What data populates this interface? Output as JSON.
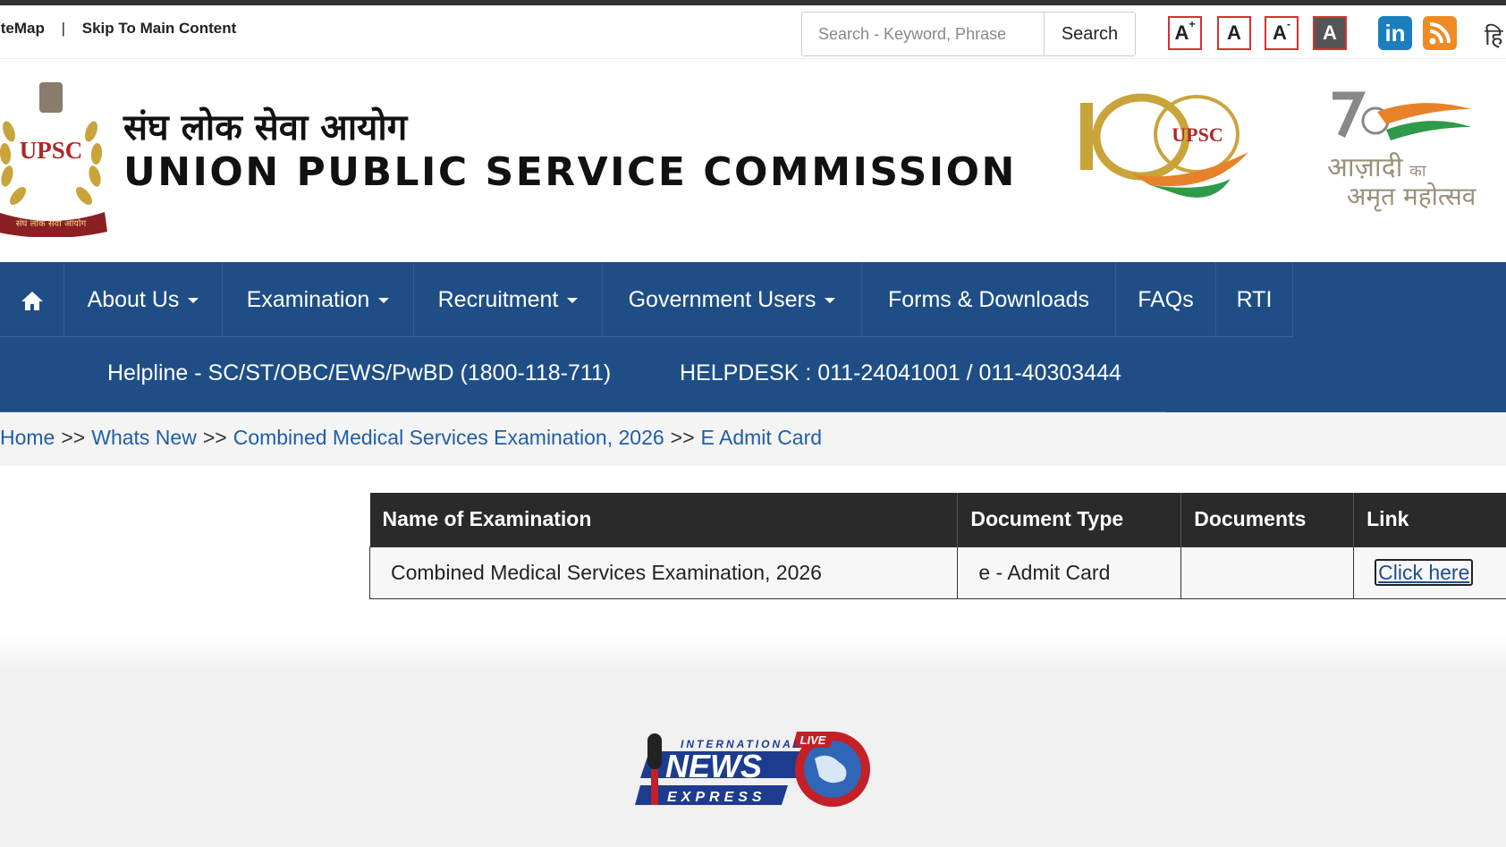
{
  "utility": {
    "sitemap": "iteMap",
    "separator": "|",
    "skip_link": "Skip To Main Content",
    "search_placeholder": "Search - Keyword, Phrase",
    "search_button": "Search",
    "font_increase": "A",
    "font_increase_sup": "+",
    "font_normal": "A",
    "font_decrease": "A",
    "font_decrease_sup": "-",
    "contrast": "A",
    "linkedin": "in",
    "language": "हि"
  },
  "header": {
    "title_hindi": "संघ लोक सेवा आयोग",
    "title_english": "UNION PUBLIC SERVICE COMMISSION",
    "emblem_text": "UPSC",
    "emblem_ribbon": "संघ लोक सेवा आयोग",
    "logo100_text": "UPSC",
    "azadi_line1": "आज़ादी",
    "azadi_ka": "का",
    "azadi_line2": "अमृत महोत्सव"
  },
  "nav": {
    "items": [
      {
        "label": "About Us"
      },
      {
        "label": "Examination"
      },
      {
        "label": "Recruitment"
      },
      {
        "label": "Government Users"
      },
      {
        "label": "Forms & Downloads"
      },
      {
        "label": "FAQs"
      },
      {
        "label": "RTI"
      }
    ],
    "helpline": "Helpline - SC/ST/OBC/EWS/PwBD (1800-118-711)",
    "helpdesk": "HELPDESK : 011-24041001 / 011-40303444"
  },
  "breadcrumb": {
    "items": [
      "Home",
      "Whats New",
      "Combined Medical Services Examination, 2026",
      "E Admit Card"
    ],
    "separator": ">>"
  },
  "table": {
    "headers": [
      "Name of Examination",
      "Document Type",
      "Documents",
      "Link"
    ],
    "rows": [
      {
        "name": "Combined Medical Services Examination, 2026",
        "type": "e - Admit Card",
        "documents": "",
        "link": "Click here"
      }
    ]
  },
  "footer": {
    "logo_international": "INTERNATIONAL",
    "logo_live": "LIVE",
    "logo_news": "NEWS",
    "logo_express": "EXPRESS"
  },
  "colors": {
    "nav_blue": "#1f4e87",
    "link_blue": "#1f5ea8",
    "accent_red": "#d9302f",
    "table_header": "#2a2a2a"
  }
}
